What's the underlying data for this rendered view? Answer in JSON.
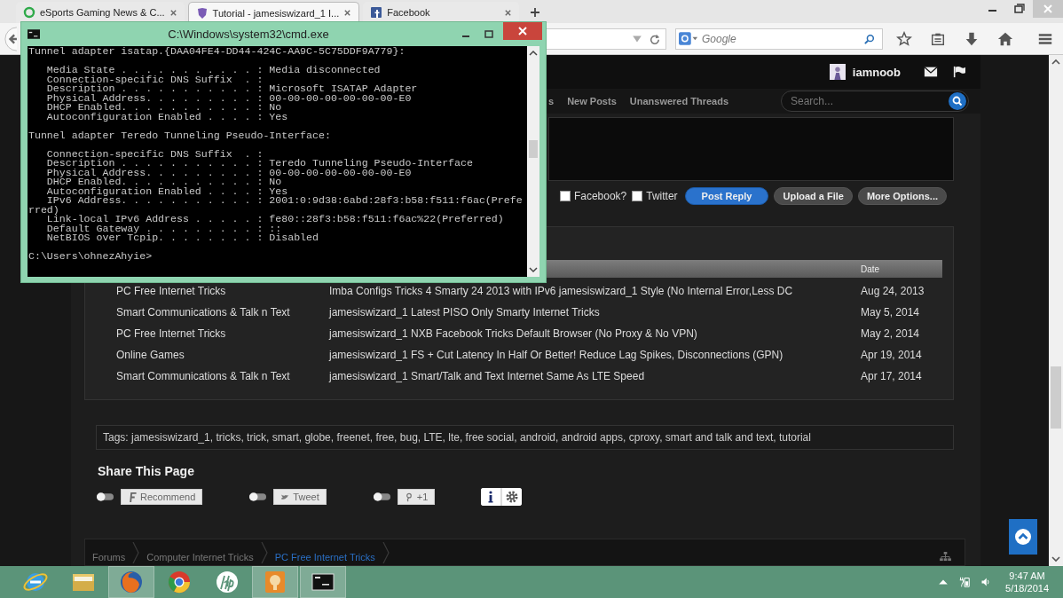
{
  "browser": {
    "tabs": [
      {
        "title": "eSports Gaming News & C...",
        "selected": false
      },
      {
        "title": "Tutorial - jamesiswizard_1 I...",
        "selected": true
      },
      {
        "title": "Facebook",
        "selected": false
      }
    ],
    "search_placeholder": "Google"
  },
  "site": {
    "username": "iamnoob",
    "nav_links": [
      "s",
      "New Posts",
      "Unanswered Threads"
    ],
    "search_placeholder": "Search...",
    "share_options": [
      {
        "label": "Facebook?",
        "checked": false
      },
      {
        "label": "Twitter",
        "checked": false
      }
    ],
    "reply_buttons": [
      {
        "label": "Post Reply",
        "kind": "primary"
      },
      {
        "label": "Upload a File",
        "kind": "secondary"
      },
      {
        "label": "More Options...",
        "kind": "secondary"
      }
    ],
    "similar_threads": {
      "columns": [
        "Date"
      ],
      "rows": [
        {
          "forum": "PC Free Internet Tricks",
          "title": "Imba Configs Tricks 4 Smarty 24 2013 with IPv6 jamesiswizard_1 Style (No Internal Error,Less DC",
          "date": "Aug 24, 2013"
        },
        {
          "forum": "Smart Communications & Talk n Text",
          "title": "jamesiswizard_1 Latest PISO Only Smarty Internet Tricks",
          "date": "May 5, 2014"
        },
        {
          "forum": "PC Free Internet Tricks",
          "title": "jamesiswizard_1 NXB Facebook Tricks Default Browser (No Proxy & No VPN)",
          "date": "May 2, 2014"
        },
        {
          "forum": "Online Games",
          "title": "jamesiswizard_1 FS + Cut Latency In Half Or Better! Reduce Lag Spikes, Disconnections (GPN)",
          "date": "Apr 19, 2014"
        },
        {
          "forum": "Smart Communications & Talk n Text",
          "title": "jamesiswizard_1 Smart/Talk and Text Internet Same As LTE Speed",
          "date": "Apr 17, 2014"
        }
      ]
    },
    "tags": "Tags: jamesiswizard_1, tricks, trick, smart, globe, freenet, free, bug, LTE, lte, free social, android, android apps, cproxy, smart and talk and text, tutorial",
    "share_title": "Share This Page",
    "share_buttons": [
      {
        "label": "Recommend",
        "kind": "facebook"
      },
      {
        "label": "Tweet",
        "kind": "twitter"
      },
      {
        "label": "+1",
        "kind": "google"
      }
    ],
    "breadcrumbs": [
      {
        "label": "Forums",
        "selected": false
      },
      {
        "label": "Computer Internet Tricks",
        "selected": false
      },
      {
        "label": "PC Free Internet Tricks",
        "selected": true
      }
    ]
  },
  "cmd": {
    "title": "C:\\Windows\\system32\\cmd.exe",
    "blocks": [
      [
        "Tunnel adapter isatap.{DAA04FE4-DD44-424C-AA9C-5C75DDF9A779}:"
      ],
      [
        "   Media State . . . . . . . . . . . : Media disconnected",
        "   Connection-specific DNS Suffix  . :",
        "   Description . . . . . . . . . . . : Microsoft ISATAP Adapter",
        "   Physical Address. . . . . . . . . : 00-00-00-00-00-00-00-E0",
        "   DHCP Enabled. . . . . . . . . . . : No",
        "   Autoconfiguration Enabled . . . . : Yes"
      ],
      [
        "Tunnel adapter Teredo Tunneling Pseudo-Interface:"
      ],
      [
        "   Connection-specific DNS Suffix  . :",
        "   Description . . . . . . . . . . . : Teredo Tunneling Pseudo-Interface",
        "   Physical Address. . . . . . . . . : 00-00-00-00-00-00-00-E0",
        "   DHCP Enabled. . . . . . . . . . . : No",
        "   Autoconfiguration Enabled . . . . : Yes",
        "   IPv6 Address. . . . . . . . . . . : 2001:0:9d38:6abd:28f3:b58:f511:f6ac(Prefe",
        "rred)",
        "   Link-local IPv6 Address . . . . . : fe80::28f3:b58:f511:f6ac%22(Preferred)",
        "   Default Gateway . . . . . . . . . : ::",
        "   NetBIOS over Tcpip. . . . . . . . : Disabled"
      ],
      [
        "C:\\Users\\ohnezAhyie>"
      ]
    ]
  },
  "taskbar": {
    "apps": [
      {
        "kind": "ie",
        "running": false
      },
      {
        "kind": "folder",
        "running": false
      },
      {
        "kind": "firefox",
        "running": true
      },
      {
        "kind": "chrome",
        "running": false
      },
      {
        "kind": "hp",
        "running": false
      },
      {
        "kind": "pidgin",
        "running": true
      },
      {
        "kind": "cmd",
        "running": true
      }
    ],
    "time": "9:47 AM",
    "date": "5/18/2014"
  }
}
